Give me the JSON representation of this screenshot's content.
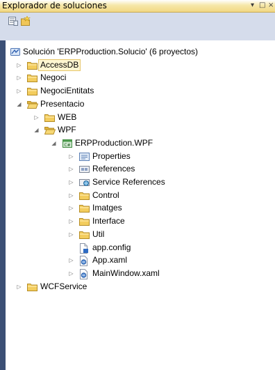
{
  "panel": {
    "title": "Explorador de soluciones",
    "pin_glyph": "▾",
    "restore_glyph": "□",
    "close_glyph": "×"
  },
  "toolbar": {
    "tools": [
      {
        "name": "properties-tool-icon"
      },
      {
        "name": "show-all-files-tool-icon"
      }
    ]
  },
  "tree": {
    "solution": {
      "label": "Solución 'ERPProduction.Solucio'  (6 proyectos)",
      "icon": "solution-icon"
    },
    "items": [
      {
        "label": "AccessDB",
        "icon": "folder-icon",
        "expander": "collapsed",
        "selected": true
      },
      {
        "label": "Negoci",
        "icon": "folder-icon",
        "expander": "collapsed"
      },
      {
        "label": "NegociEntitats",
        "icon": "folder-icon",
        "expander": "collapsed"
      },
      {
        "label": "Presentacio",
        "icon": "folder-open-icon",
        "expander": "expanded"
      },
      {
        "label": "WEB",
        "icon": "folder-icon",
        "expander": "collapsed"
      },
      {
        "label": "WPF",
        "icon": "folder-open-icon",
        "expander": "expanded"
      },
      {
        "label": "ERPProduction.WPF",
        "icon": "wpf-project-icon",
        "expander": "expanded"
      },
      {
        "label": "Properties",
        "icon": "properties-icon",
        "expander": "collapsed"
      },
      {
        "label": "References",
        "icon": "references-icon",
        "expander": "collapsed"
      },
      {
        "label": "Service References",
        "icon": "service-references-icon",
        "expander": "collapsed"
      },
      {
        "label": "Control",
        "icon": "folder-icon",
        "expander": "collapsed"
      },
      {
        "label": "Imatges",
        "icon": "folder-icon",
        "expander": "collapsed"
      },
      {
        "label": "Interface",
        "icon": "folder-icon",
        "expander": "collapsed"
      },
      {
        "label": "Util",
        "icon": "folder-icon",
        "expander": "collapsed"
      },
      {
        "label": "app.config",
        "icon": "config-file-icon",
        "expander": "none"
      },
      {
        "label": "App.xaml",
        "icon": "xaml-file-icon",
        "expander": "collapsed"
      },
      {
        "label": "MainWindow.xaml",
        "icon": "xaml-file-icon",
        "expander": "collapsed"
      },
      {
        "label": "WCFService",
        "icon": "folder-icon",
        "expander": "collapsed"
      }
    ]
  },
  "colors": {
    "title_gradient_top": "#ffffff",
    "title_gradient_bottom": "#f2d884",
    "frame": "#3b4f75",
    "toolbar": "#d5dceb",
    "tree_background": "#ffffff",
    "selection_fill": "#fff6d1",
    "selection_border": "#e6c66a",
    "folder": "#f0c659"
  }
}
